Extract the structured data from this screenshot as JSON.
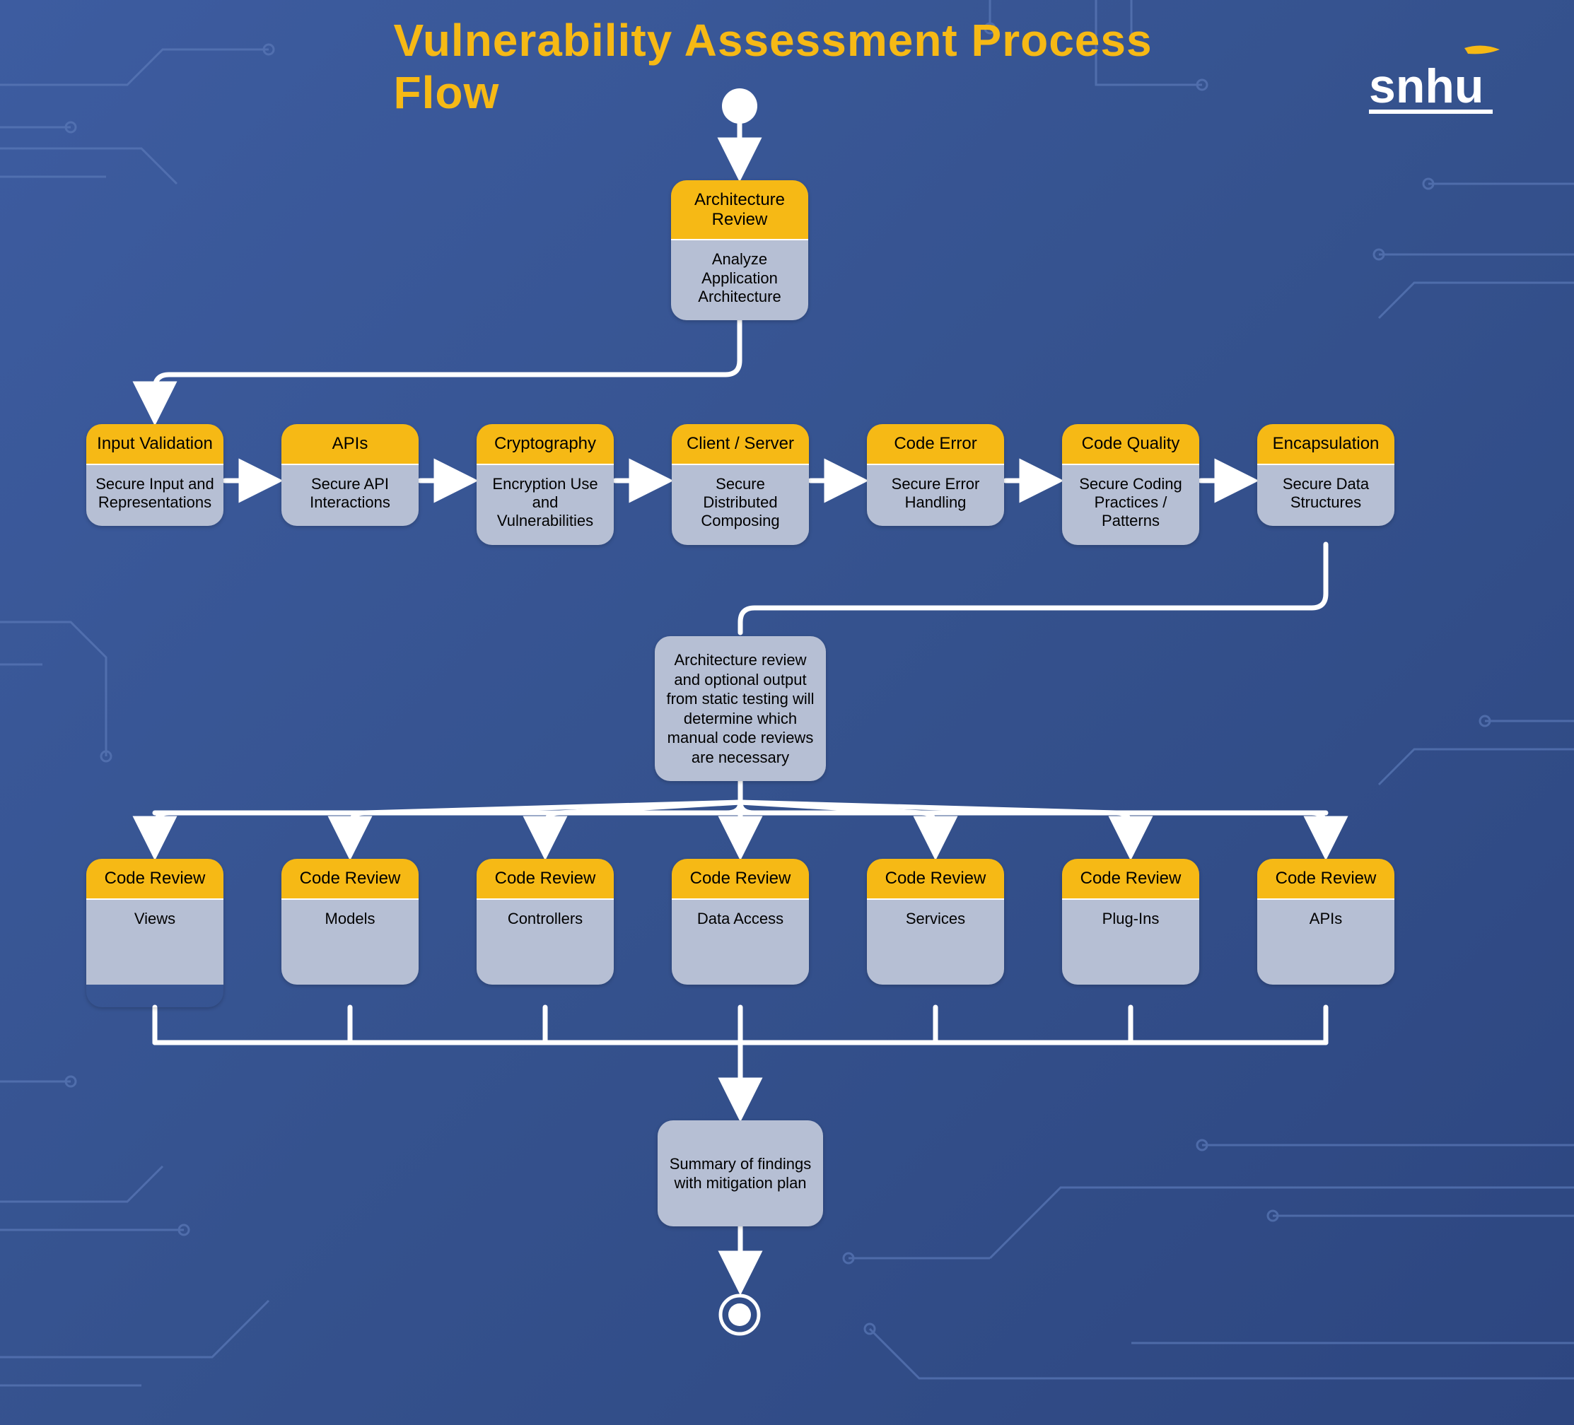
{
  "title": "Vulnerability Assessment Process Flow",
  "logo_text": "snhu",
  "architecture": {
    "title": "Architecture Review",
    "body": "Analyze Application Architecture"
  },
  "row2": [
    {
      "title": "Input Validation",
      "body": "Secure Input and Representations"
    },
    {
      "title": "APIs",
      "body": "Secure API Interactions"
    },
    {
      "title": "Cryptography",
      "body": "Encryption Use and Vulnerabilities"
    },
    {
      "title": "Client / Server",
      "body": "Secure Distributed Composing"
    },
    {
      "title": "Code Error",
      "body": "Secure Error Handling"
    },
    {
      "title": "Code Quality",
      "body": "Secure Coding Practices / Patterns"
    },
    {
      "title": "Encapsulation",
      "body": "Secure Data Structures"
    }
  ],
  "review_note": "Architecture review and optional output from static testing will determine which manual code reviews are necessary",
  "code_review_header": "Code Review",
  "row3": [
    {
      "body": "Views"
    },
    {
      "body": "Models"
    },
    {
      "body": "Controllers"
    },
    {
      "body": "Data Access"
    },
    {
      "body": "Services"
    },
    {
      "body": "Plug-Ins"
    },
    {
      "body": "APIs"
    }
  ],
  "summary": "Summary of findings with mitigation plan"
}
